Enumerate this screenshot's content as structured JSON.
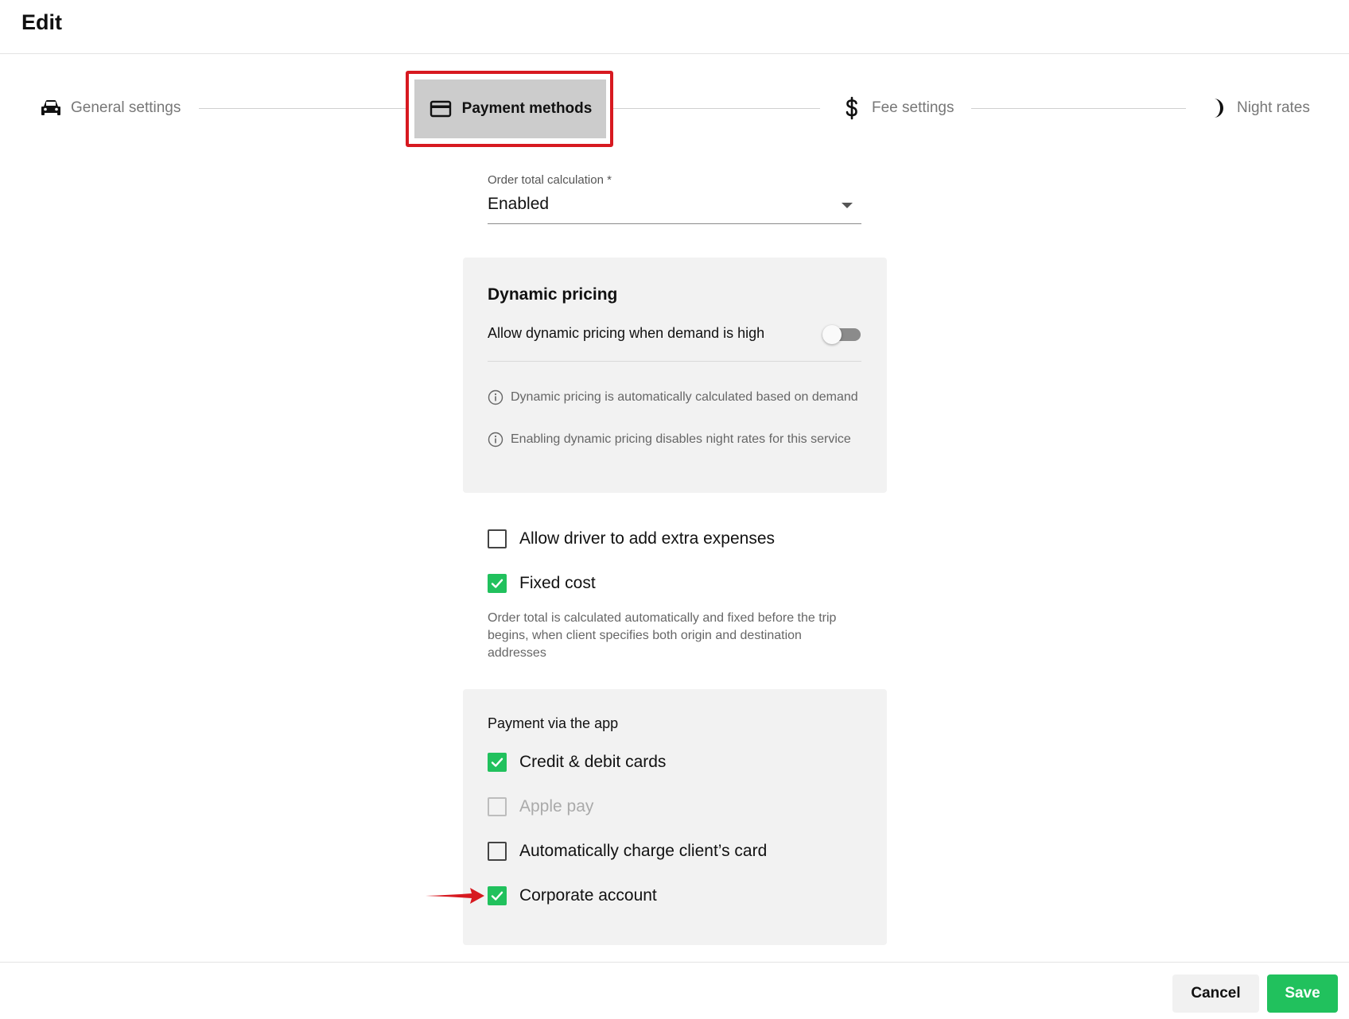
{
  "header": {
    "title": "Edit"
  },
  "stepper": {
    "steps": [
      {
        "label": "General settings",
        "icon": "car-icon"
      },
      {
        "label": "Payment methods",
        "icon": "credit-card-icon",
        "active": true
      },
      {
        "label": "Fee settings",
        "icon": "dollar-icon"
      },
      {
        "label": "Night rates",
        "icon": "moon-icon"
      }
    ]
  },
  "order_total": {
    "label": "Order total calculation *",
    "value": "Enabled"
  },
  "dynamic_pricing": {
    "title": "Dynamic pricing",
    "toggle_label": "Allow dynamic pricing when demand is high",
    "toggle_on": false,
    "info": [
      "Dynamic pricing is automatically calculated based on demand",
      "Enabling dynamic pricing disables night rates for this service"
    ]
  },
  "options": {
    "extra_expenses": {
      "label": "Allow driver to add extra expenses",
      "checked": false
    },
    "fixed_cost": {
      "label": "Fixed cost",
      "checked": true
    },
    "fixed_cost_note": "Order total is calculated automatically and fixed before the trip begins, when client specifies both origin and destination addresses"
  },
  "payment_app": {
    "title": "Payment via the app",
    "items": [
      {
        "label": "Credit & debit cards",
        "checked": true,
        "disabled": false
      },
      {
        "label": "Apple pay",
        "checked": false,
        "disabled": true
      },
      {
        "label": "Automatically charge client’s card",
        "checked": false,
        "disabled": false
      },
      {
        "label": "Corporate account",
        "checked": true,
        "disabled": false
      }
    ]
  },
  "footer": {
    "cancel_label": "Cancel",
    "save_label": "Save"
  },
  "colors": {
    "accent_green": "#21c15d",
    "highlight_red": "#d71920",
    "active_step_bg": "#cccccc"
  }
}
